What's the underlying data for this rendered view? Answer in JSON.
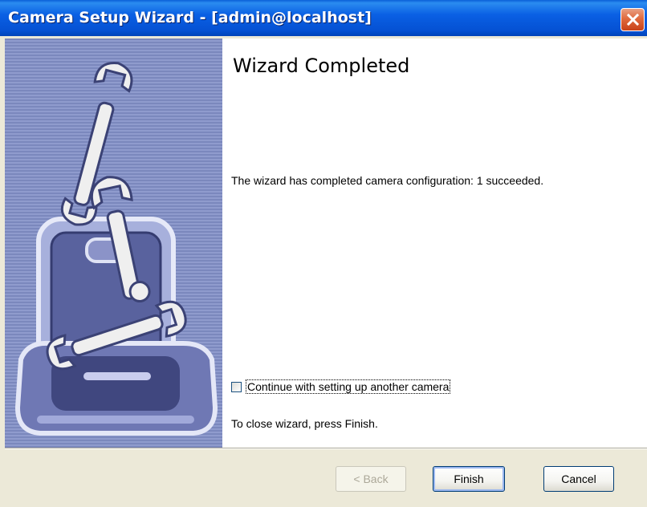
{
  "window": {
    "title": "Camera Setup Wizard - [admin@localhost]",
    "close_icon": "close-icon"
  },
  "page": {
    "heading": "Wizard Completed",
    "message": "The wizard has completed camera configuration: 1 succeeded.",
    "checkbox": {
      "label": "Continue with setting up another camera",
      "checked": false
    },
    "close_hint": "To close wizard, press Finish."
  },
  "buttons": {
    "back": "< Back",
    "finish": "Finish",
    "cancel": "Cancel"
  },
  "banner": {
    "illustration": "toolbox-wrenches-icon"
  },
  "colors": {
    "titlebar": "#0a5fd8",
    "banner_stripe_dark": "#7b88bd",
    "banner_stripe_light": "#8f9bcd",
    "dialog_background": "#ece9d8"
  }
}
